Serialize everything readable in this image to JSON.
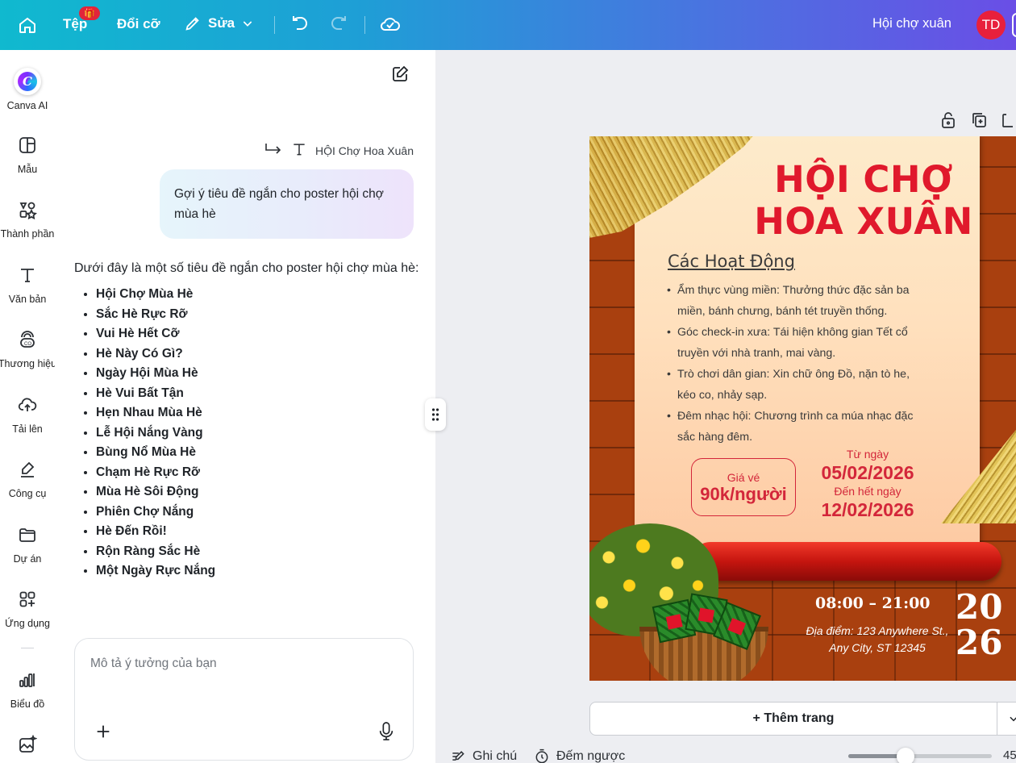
{
  "topbar": {
    "file_label": "Tệp",
    "file_badge": "🎁",
    "resize_label": "Đổi cỡ",
    "edit_label": "Sửa",
    "design_title": "Hội chợ xuân",
    "avatar_initials": "TD"
  },
  "rail": {
    "items": [
      {
        "label": "Canva AI",
        "icon": "canva-ai-icon"
      },
      {
        "label": "Mẫu",
        "icon": "templates-icon"
      },
      {
        "label": "Thành phần",
        "icon": "elements-icon"
      },
      {
        "label": "Văn bản",
        "icon": "text-icon"
      },
      {
        "label": "Thương hiệu",
        "icon": "brand-icon"
      },
      {
        "label": "Tải lên",
        "icon": "upload-icon"
      },
      {
        "label": "Công cụ",
        "icon": "tools-icon"
      },
      {
        "label": "Dự án",
        "icon": "projects-icon"
      },
      {
        "label": "Ứng dụng",
        "icon": "apps-icon"
      },
      {
        "label": "Biểu đồ",
        "icon": "chart-icon"
      }
    ]
  },
  "chat": {
    "reference_label": "HỘI Chợ Hoa Xuân",
    "user_message": "Gợi ý tiêu đề ngắn cho poster hội chợ mùa hè",
    "answer_intro": "Dưới đây là một số tiêu đề ngắn cho poster hội chợ mùa hè:",
    "suggestions": [
      "Hội Chợ Mùa Hè",
      "Sắc Hè Rực Rỡ",
      "Vui Hè Hết Cỡ",
      "Hè Này Có Gì?",
      "Ngày Hội Mùa Hè",
      "Hè Vui Bất Tận",
      "Hẹn Nhau Mùa Hè",
      "Lễ Hội Nắng Vàng",
      "Bùng Nổ Mùa Hè",
      "Chạm Hè Rực Rỡ",
      "Mùa Hè Sôi Động",
      "Phiên Chợ Nắng",
      "Hè Đến Rồi!",
      "Rộn Ràng Sắc Hè",
      "Một Ngày Rực Nắng"
    ],
    "input_placeholder": "Mô tả ý tưởng của bạn"
  },
  "poster": {
    "title_line1": "HỘI CHỢ",
    "title_line2": "HOA XUÂN",
    "activities_heading": "Các Hoạt Động",
    "activities": [
      "Ẩm thực vùng miền: Thưởng thức đặc sản ba miền, bánh chưng, bánh tét truyền thống.",
      "Góc check-in xưa: Tái hiện không gian Tết cổ truyền với nhà tranh, mai vàng.",
      "Trò chơi dân gian: Xin chữ ông Đồ, nặn tò he, kéo co, nhảy sạp.",
      "Đêm nhạc hội: Chương trình ca múa nhạc đặc sắc hàng đêm."
    ],
    "ticket_label": "Giá vé",
    "ticket_price": "90k/người",
    "from_label": "Từ ngày",
    "from_date": "05/02/2026",
    "to_label": "Đến hết ngày",
    "to_date": "12/02/2026",
    "time": "08:00 – 21:00",
    "address": "Địa điểm: 123 Anywhere St., Any City, ST 12345",
    "year_top": "20",
    "year_bottom": "26",
    "colors": {
      "red": "#e0192c",
      "brick": "#a9400f"
    }
  },
  "canvas": {
    "add_page_label": "+ Thêm trang",
    "notes_label": "Ghi chú",
    "timer_label": "Đếm ngược",
    "zoom_label": "45",
    "zoom_fraction": 0.4
  }
}
